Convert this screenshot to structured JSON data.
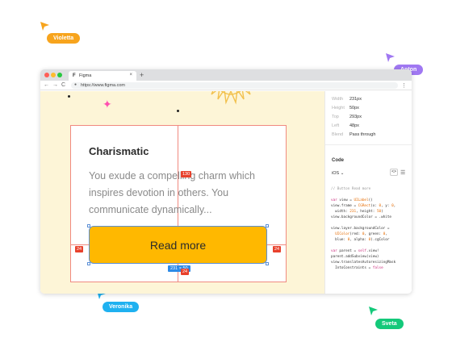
{
  "cursors": [
    {
      "name": "Violetta",
      "color": "#f7a41d"
    },
    {
      "name": "Anton",
      "color": "#a078f2"
    },
    {
      "name": "Veronika",
      "color": "#1fb1f0"
    },
    {
      "name": "Sveta",
      "color": "#14c97a"
    }
  ],
  "browser": {
    "tab_title": "Figma",
    "tab_close": "×",
    "new_tab": "+",
    "url": "https://www.figma.com",
    "back": "←",
    "forward": "→",
    "reload": "C",
    "menu": "⋮",
    "favicon": "F"
  },
  "card": {
    "heading": "Charismatic",
    "body": "You exude a compelling charm which inspires devotion in others. You communicate dynamically...",
    "button_label": "Read more"
  },
  "measurements": {
    "top_gap": "130",
    "left_gap": "24",
    "right_gap": "24",
    "bottom_gap": "24",
    "size": "231 × 50"
  },
  "inspector": {
    "props": [
      {
        "label": "Width",
        "value": "231px"
      },
      {
        "label": "Height",
        "value": "50px"
      },
      {
        "label": "Top",
        "value": "293px"
      },
      {
        "label": "Left",
        "value": "48px"
      },
      {
        "label": "Blend",
        "value": "Pass through"
      }
    ],
    "code_title": "Code",
    "language": "iOS ⌄",
    "code_icon": "<>",
    "list_icon": "☰",
    "code_lines": [
      "// Button Read more",
      "",
      "var view = UILabel()",
      "view.frame = CGRect(x: 0, y: 0,",
      "  width: 231, height: 50)",
      "view.backgroundColor = .white",
      "",
      "view.layer.backgroundColor =",
      "  UIColor(red: 0, green: 0,",
      "  blue: 0, alpha: 0).cgColor",
      "",
      "var parent = self.view!",
      "parent.addSubview(view)",
      "view.translatesAutoresizingMask",
      "  IntoConstraints = false"
    ]
  },
  "colors": {
    "accent_yellow": "#ffb800",
    "guide_red": "#f08a80",
    "selection_blue": "#5b8fd6",
    "badge_red": "#e8412c",
    "canvas_bg": "#fdf5d7"
  }
}
